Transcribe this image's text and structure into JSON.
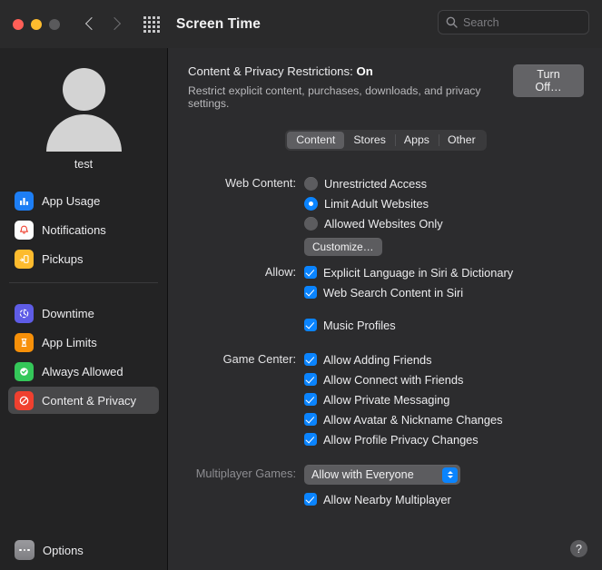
{
  "window": {
    "title": "Screen Time",
    "traffic_lights": [
      "close",
      "minimize",
      "zoom"
    ]
  },
  "toolbar": {
    "back_icon": "chevron-left-icon",
    "forward_icon": "chevron-right-icon",
    "grid_icon": "grid-apps-icon",
    "search": {
      "placeholder": "Search",
      "value": ""
    }
  },
  "sidebar": {
    "profile": {
      "name": "test",
      "avatar_icon": "person-avatar-icon"
    },
    "items": [
      {
        "label": "App Usage",
        "icon": "bar-chart-icon",
        "color": "#1d7ef5",
        "selected": false
      },
      {
        "label": "Notifications",
        "icon": "bell-icon",
        "color": "#fdfdfd",
        "selected": false
      },
      {
        "label": "Pickups",
        "icon": "phone-pickup-icon",
        "color": "#fdbb2e",
        "selected": false
      },
      {
        "label": "Downtime",
        "icon": "clock-icon",
        "color": "#5e5ce6",
        "selected": false
      },
      {
        "label": "App Limits",
        "icon": "hourglass-icon",
        "color": "#f79009",
        "selected": false
      },
      {
        "label": "Always Allowed",
        "icon": "check-badge-icon",
        "color": "#34c759",
        "selected": false
      },
      {
        "label": "Content & Privacy",
        "icon": "no-entry-icon",
        "color": "#f0402f",
        "selected": true
      }
    ],
    "divider_after_index": 2,
    "options": {
      "label": "Options",
      "icon": "ellipsis-icon"
    }
  },
  "main": {
    "header": {
      "title_prefix": "Content & Privacy Restrictions:",
      "status": "On",
      "subtitle": "Restrict explicit content, purchases, downloads, and privacy settings.",
      "turn_off_label": "Turn Off…"
    },
    "tabs": [
      {
        "label": "Content",
        "active": true
      },
      {
        "label": "Stores",
        "active": false
      },
      {
        "label": "Apps",
        "active": false
      },
      {
        "label": "Other",
        "active": false
      }
    ],
    "web_content": {
      "label": "Web Content:",
      "options": [
        {
          "label": "Unrestricted Access",
          "selected": false
        },
        {
          "label": "Limit Adult Websites",
          "selected": true
        },
        {
          "label": "Allowed Websites Only",
          "selected": false
        }
      ],
      "customize_label": "Customize…"
    },
    "allow": {
      "label": "Allow:",
      "items": [
        {
          "label": "Explicit Language in Siri & Dictionary",
          "checked": true
        },
        {
          "label": "Web Search Content in Siri",
          "checked": true
        }
      ],
      "extra": [
        {
          "label": "Music Profiles",
          "checked": true
        }
      ]
    },
    "game_center": {
      "label": "Game Center:",
      "items": [
        {
          "label": "Allow Adding Friends",
          "checked": true
        },
        {
          "label": "Allow Connect with Friends",
          "checked": true
        },
        {
          "label": "Allow Private Messaging",
          "checked": true
        },
        {
          "label": "Allow Avatar & Nickname Changes",
          "checked": true
        },
        {
          "label": "Allow Profile Privacy Changes",
          "checked": true
        }
      ]
    },
    "multiplayer": {
      "label": "Multiplayer Games:",
      "selected_option": "Allow with Everyone",
      "nearby": {
        "label": "Allow Nearby Multiplayer",
        "checked": true
      }
    },
    "help_label": "?"
  },
  "colors": {
    "accent": "#0a84ff",
    "window_bg": "#2c2c2e",
    "sidebar_bg": "#232324",
    "toolbar_bg": "#2a2a2b",
    "selected_row": "#48484a"
  }
}
